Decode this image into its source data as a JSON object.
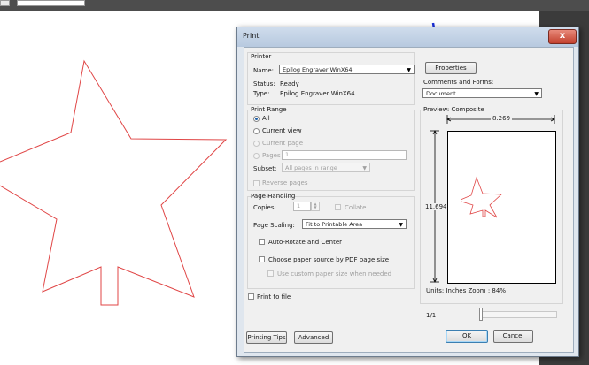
{
  "dialog": {
    "title": "Print",
    "close_glyph": "x"
  },
  "printer": {
    "section_label": "Printer",
    "name_label": "Name:",
    "name_value": "Epilog Engraver WinX64",
    "status_label": "Status:",
    "status_value": "Ready",
    "type_label": "Type:",
    "type_value": "Epilog Engraver WinX64",
    "properties_label": "Properties",
    "comments_label": "Comments and Forms:",
    "comments_value": "Document"
  },
  "print_range": {
    "section_label": "Print Range",
    "all_label": "All",
    "current_view_label": "Current view",
    "current_page_label": "Current page",
    "pages_label": "Pages",
    "pages_value": "1",
    "subset_label": "Subset:",
    "subset_value": "All pages in range",
    "reverse_label": "Reverse pages"
  },
  "page_handling": {
    "section_label": "Page Handling",
    "copies_label": "Copies:",
    "copies_value": "1",
    "collate_label": "Collate",
    "scaling_label": "Page Scaling:",
    "scaling_value": "Fit to Printable Area",
    "auto_rotate_label": "Auto-Rotate and Center",
    "choose_source_label": "Choose paper source by PDF page size",
    "custom_size_label": "Use custom paper size when needed"
  },
  "print_to_file_label": "Print to file",
  "preview": {
    "label": "Preview: Composite",
    "width_value": "8.269",
    "height_value": "11.694",
    "units_zoom": "Units: Inches Zoom :  84%",
    "page_indicator": "1/1"
  },
  "buttons": {
    "printing_tips": "Printing Tips",
    "advanced": "Advanced",
    "ok": "OK",
    "cancel": "Cancel"
  },
  "colors": {
    "star_stroke": "#e04646",
    "annotation_arrow": "#1a2fd8",
    "ok_border": "#3c7fb1"
  },
  "icons": {
    "close": "close-icon",
    "dropdown": "chevron-down-icon",
    "spinner": "spinner-arrows-icon"
  }
}
